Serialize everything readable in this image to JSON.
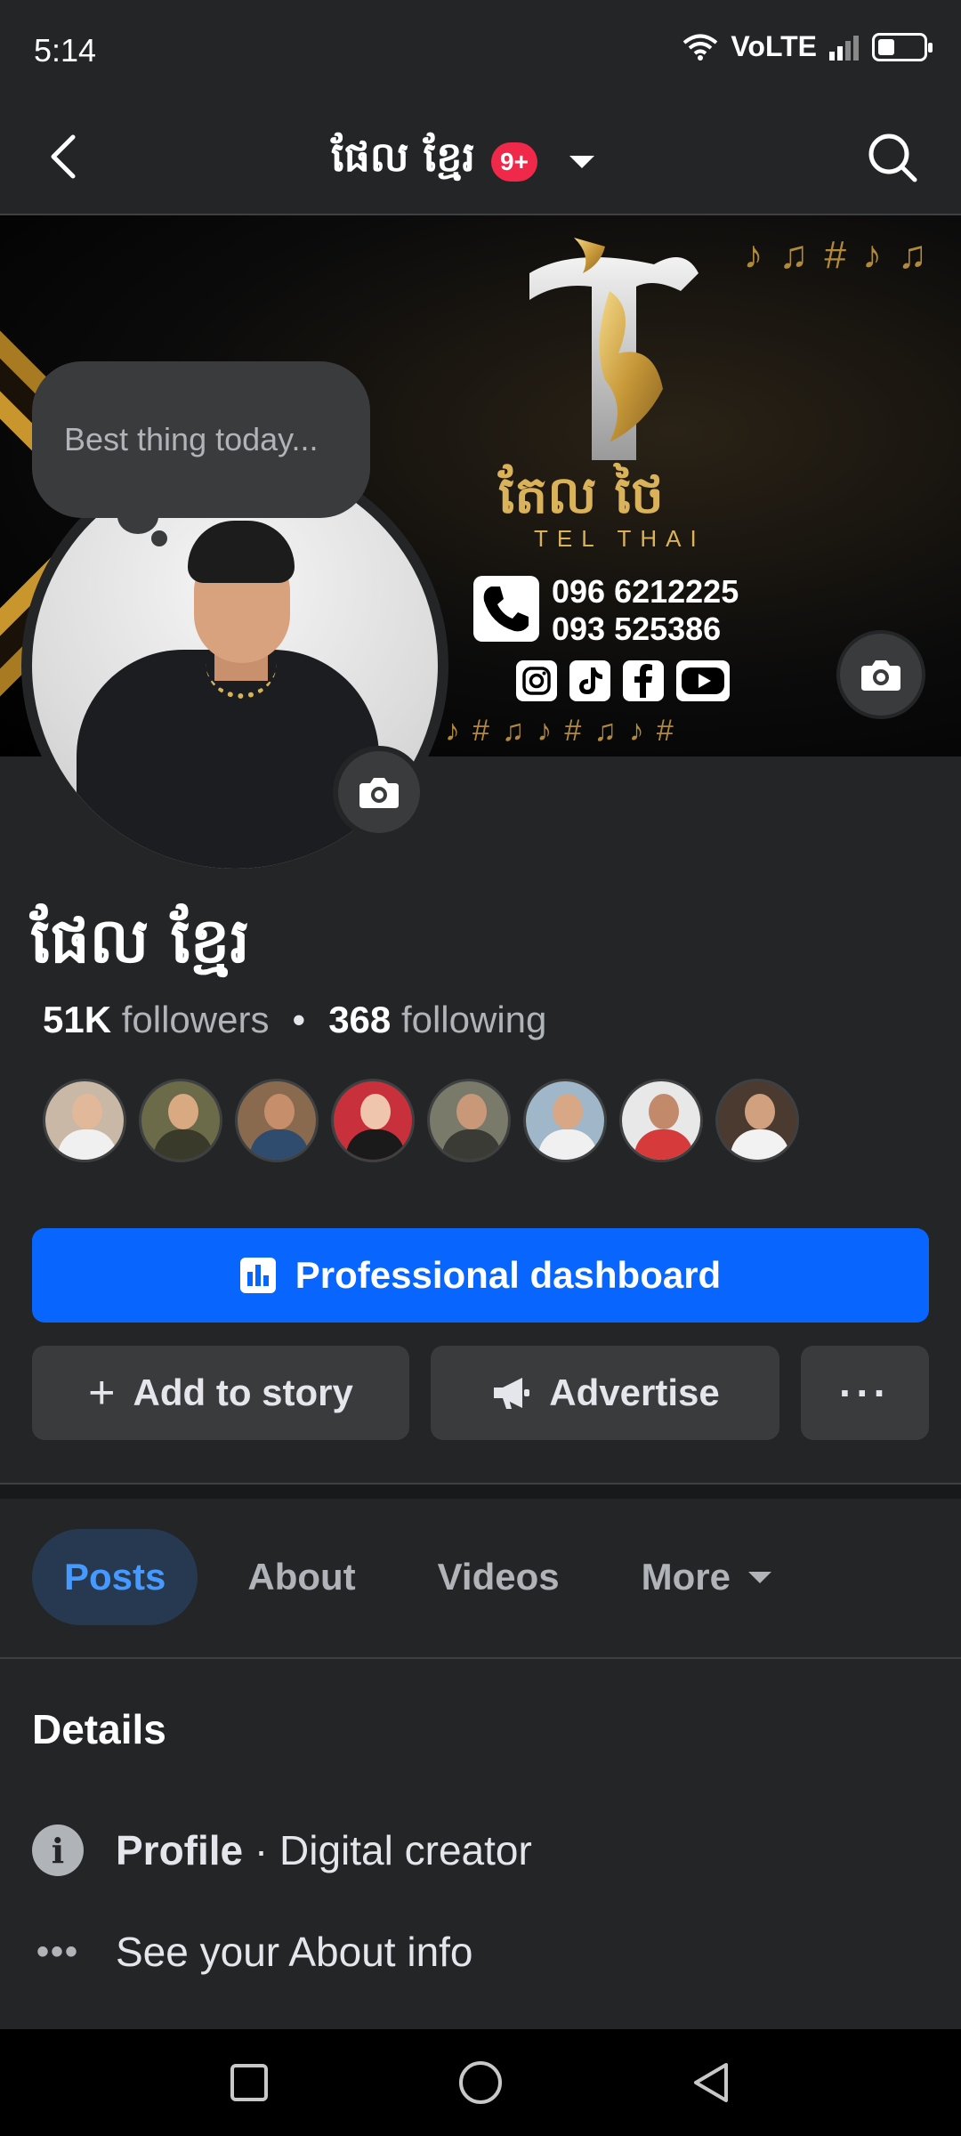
{
  "status": {
    "time": "5:14",
    "network": "VoLTE",
    "battery_level": 0.35
  },
  "appbar": {
    "title": "ផែល ខ្មែរ",
    "badge": "9+",
    "back_icon": "chevron-left-icon",
    "search_icon": "search-icon"
  },
  "cover": {
    "brand": "តែល ថៃ",
    "brand_sub": "TEL THAI",
    "phones": [
      "096 6212225",
      "093 525386"
    ],
    "socials": [
      "instagram-icon",
      "tiktok-icon",
      "facebook-icon",
      "youtube-icon"
    ]
  },
  "thought_bubble": {
    "placeholder": "Best thing today..."
  },
  "profile": {
    "name": "ផែល ខ្មែរ",
    "followers_count": "51K",
    "followers_label": "followers",
    "following_count": "368",
    "following_label": "following",
    "friend_avatars": [
      {
        "bg": "#c9b8a6",
        "head": "#e2b89a",
        "body": "#f0f0f0"
      },
      {
        "bg": "#6b6b4a",
        "head": "#d9a982",
        "body": "#3a3a2a"
      },
      {
        "bg": "#8a6a4f",
        "head": "#c68e6b",
        "body": "#2f4b6e"
      },
      {
        "bg": "#c8303c",
        "head": "#efc5ad",
        "body": "#1a1a1a"
      },
      {
        "bg": "#7a7a6a",
        "head": "#c99878",
        "body": "#3b3b35"
      },
      {
        "bg": "#9fb7c8",
        "head": "#d8a886",
        "body": "#f0f0f0"
      },
      {
        "bg": "#e8e8e8",
        "head": "#c28a6a",
        "body": "#d63a3a"
      },
      {
        "bg": "#4a3a30",
        "head": "#d1a07e",
        "body": "#f2f2f2"
      }
    ]
  },
  "actions": {
    "primary": "Professional dashboard",
    "add_story": "Add to story",
    "advertise": "Advertise",
    "more": "···"
  },
  "tabs": [
    {
      "label": "Posts",
      "active": true
    },
    {
      "label": "About"
    },
    {
      "label": "Videos"
    },
    {
      "label": "More"
    }
  ],
  "details": {
    "title": "Details",
    "profile_label": "Profile",
    "profile_value": " · Digital creator",
    "about_link": "See your About info"
  },
  "colors": {
    "accent": "#0866ff",
    "background": "#242526",
    "badge": "#f02849",
    "active_tab_bg": "#263951",
    "active_tab_text": "#4599ff"
  }
}
